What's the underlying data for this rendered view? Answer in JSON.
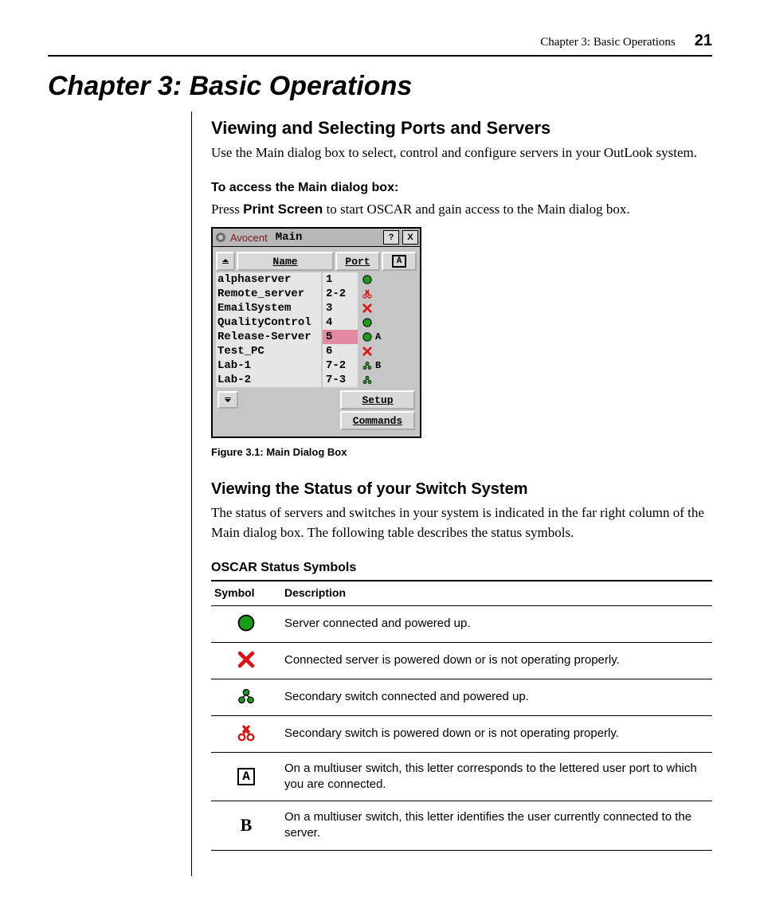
{
  "running_head": {
    "text": "Chapter 3: Basic Operations",
    "page": "21"
  },
  "chapter_title": "Chapter 3: Basic Operations",
  "section1": {
    "heading": "Viewing and Selecting Ports and Servers",
    "intro": "Use the Main dialog box to select, control and configure servers in your OutLook system.",
    "sub_heading": "To access the Main dialog box:",
    "step_pre": "Press ",
    "step_bold": "Print Screen",
    "step_post": " to start OSCAR and gain access to the Main dialog box."
  },
  "dialog": {
    "brand": "Avocent",
    "title": "Main",
    "help_btn": "?",
    "close_btn": "X",
    "col_name": "Name",
    "col_port": "Port",
    "col_user_icon": "A",
    "rows": [
      {
        "name": "alphaserver",
        "port": "1",
        "status": "green",
        "user": ""
      },
      {
        "name": "Remote_server",
        "port": "2-2",
        "status": "switch-down",
        "user": ""
      },
      {
        "name": "EmailSystem",
        "port": "3",
        "status": "red-x",
        "user": ""
      },
      {
        "name": "QualityControl",
        "port": "4",
        "status": "green",
        "user": ""
      },
      {
        "name": "Release-Server",
        "port": "5",
        "status": "green",
        "user": "A",
        "selected": true
      },
      {
        "name": "Test_PC",
        "port": "6",
        "status": "red-x",
        "user": ""
      },
      {
        "name": "Lab-1",
        "port": "7-2",
        "status": "switch-up",
        "user": "B"
      },
      {
        "name": "Lab-2",
        "port": "7-3",
        "status": "switch-up",
        "user": ""
      }
    ],
    "setup_btn": "Setup",
    "commands_btn": "Commands"
  },
  "figure_caption": "Figure 3.1: Main Dialog Box",
  "section2": {
    "heading": "Viewing the Status of your Switch System",
    "body": "The status of servers and switches in your system is indicated in the far right column of the Main dialog box. The following table describes the status symbols."
  },
  "symbols_heading": "OSCAR Status Symbols",
  "symbols_table": {
    "col_symbol": "Symbol",
    "col_desc": "Description",
    "rows": [
      {
        "icon": "green",
        "desc": "Server connected and powered up."
      },
      {
        "icon": "red-x",
        "desc": "Connected server is powered down or is not operating properly."
      },
      {
        "icon": "switch-up",
        "desc": "Secondary switch connected and powered up."
      },
      {
        "icon": "switch-down",
        "desc": "Secondary switch is powered down or is not operating properly."
      },
      {
        "icon": "boxed-a",
        "desc": "On a multiuser switch, this letter corresponds to the lettered user port to which you are connected."
      },
      {
        "icon": "letter-b",
        "desc": "On a multiuser switch, this letter identifies the user currently connected to the server."
      }
    ]
  }
}
